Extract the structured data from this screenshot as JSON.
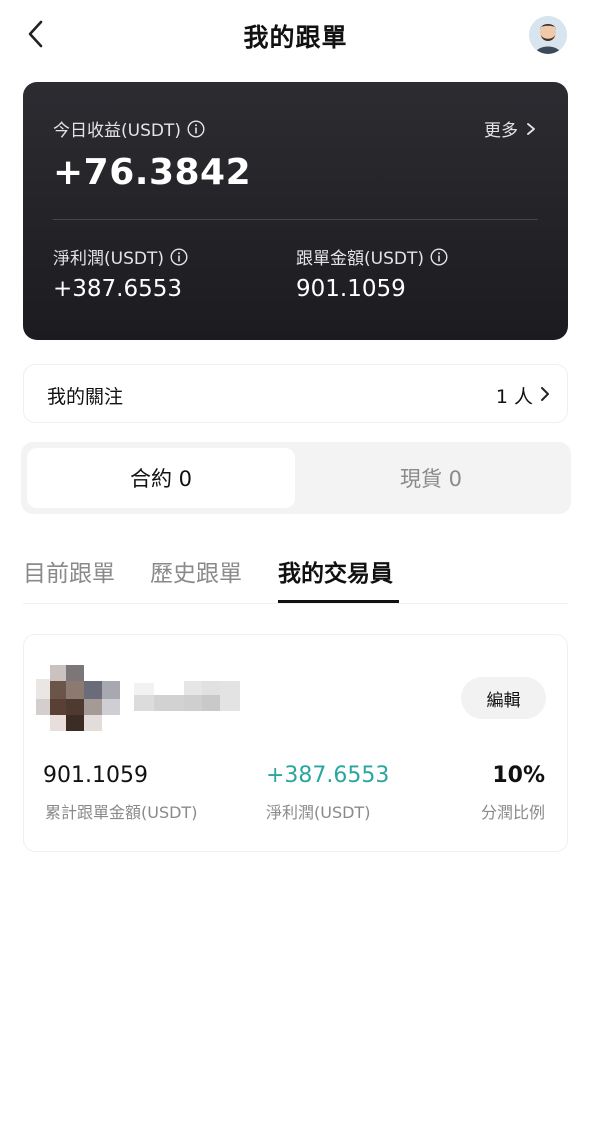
{
  "header": {
    "title": "我的跟單",
    "back_icon": "chevron-left-icon",
    "avatar_icon": "user-avatar-icon"
  },
  "summary": {
    "today_label": "今日收益(USDT)",
    "more_label": "更多",
    "today_value": "+76.3842",
    "net_profit_label": "淨利潤(USDT)",
    "net_profit_value": "+387.6553",
    "copy_amount_label": "跟單金額(USDT)",
    "copy_amount_value": "901.1059"
  },
  "following": {
    "label": "我的關注",
    "count": "1 人"
  },
  "segment": {
    "tabs": [
      {
        "label": "合約 0",
        "active": true
      },
      {
        "label": "現貨 0",
        "active": false
      }
    ]
  },
  "tabs": [
    {
      "label": "目前跟單",
      "active": false
    },
    {
      "label": "歷史跟單",
      "active": false
    },
    {
      "label": "我的交易員",
      "active": true
    }
  ],
  "trader": {
    "edit_label": "編輯",
    "stats": [
      {
        "value": "901.1059",
        "label": "累計跟單金額(USDT)"
      },
      {
        "value": "+387.6553",
        "label": "淨利潤(USDT)"
      },
      {
        "value": "10%",
        "label": "分潤比例"
      }
    ]
  },
  "colors": {
    "accent_teal": "#2aa6a0",
    "card_dark": "#1f1f23"
  }
}
